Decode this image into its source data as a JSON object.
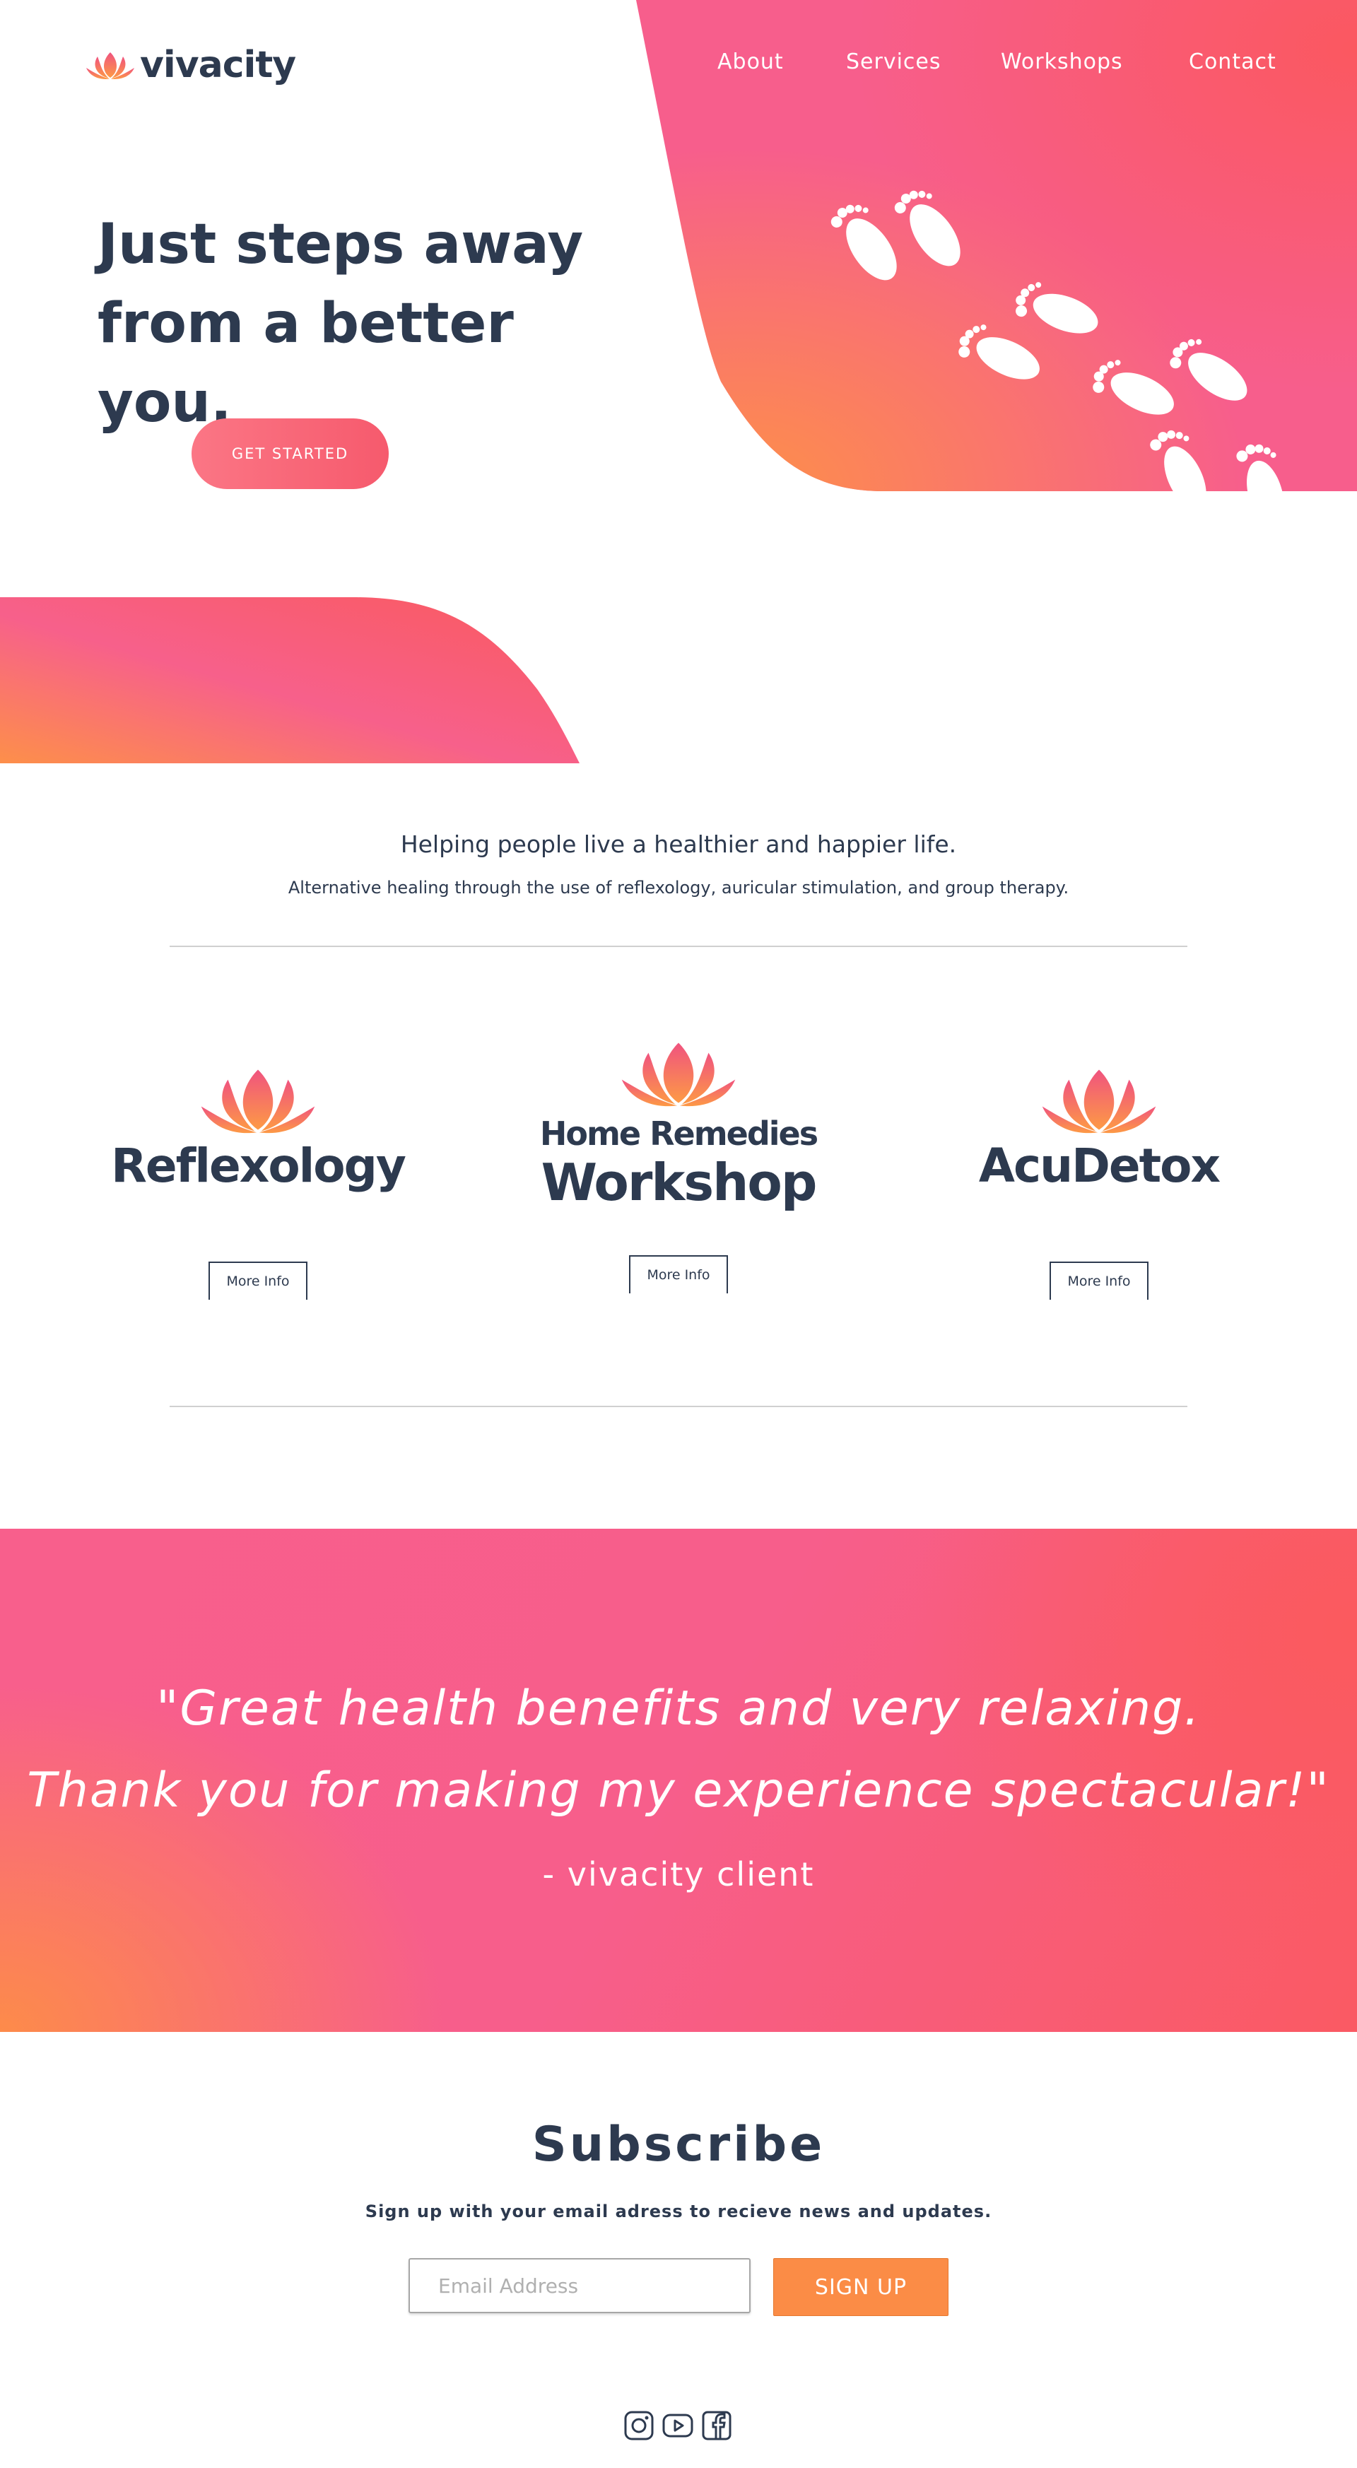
{
  "brand": {
    "name": "vivacity"
  },
  "nav": {
    "about": "About",
    "services": "Services",
    "workshops": "Workshops",
    "contact": "Contact"
  },
  "hero": {
    "headline_line1": "Just steps away",
    "headline_line2": "from a better you.",
    "cta": "GET STARTED"
  },
  "intro": {
    "title": "Helping people live a healthier and happier life.",
    "subtitle": "Alternative healing through the use of reflexology, auricular stimulation, and group therapy."
  },
  "services": [
    {
      "name": "Reflexology",
      "button": "More Info"
    },
    {
      "name_line1": "Home Remedies",
      "name_line2": "Workshop",
      "button": "More Info"
    },
    {
      "name": "AcuDetox",
      "button": "More Info"
    }
  ],
  "testimonial": {
    "line1": "\"Great health benefits and very relaxing.",
    "line2": "Thank you for making my experience spectacular!\"",
    "author": "- vivacity client"
  },
  "subscribe": {
    "title": "Subscribe",
    "text": "Sign up with your email adress to recieve news and updates.",
    "email_placeholder": "Email Address",
    "button": "SIGN UP"
  },
  "social": [
    "instagram-icon",
    "youtube-icon",
    "facebook-icon"
  ],
  "colors": {
    "pink": "#f85f8c",
    "coral": "#fa5a63",
    "orange": "#fd8b4a",
    "navy": "#2d3a4f"
  }
}
